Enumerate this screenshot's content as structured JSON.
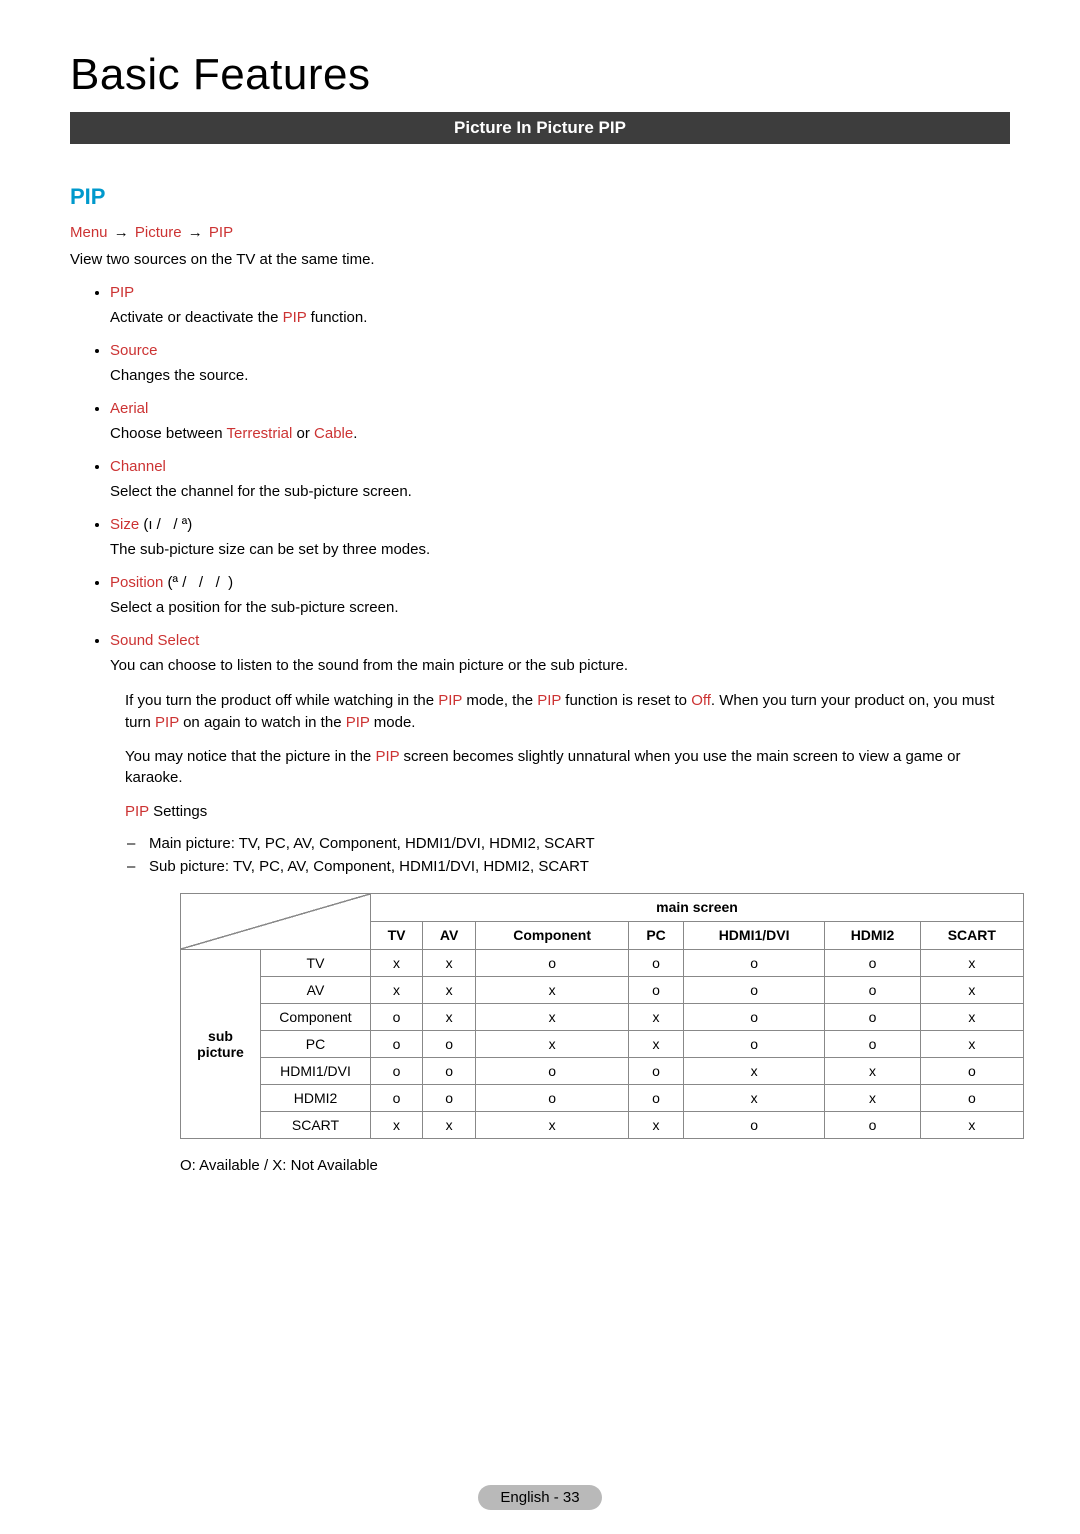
{
  "header": {
    "title": "Basic Features",
    "banner": "Picture In Picture PIP"
  },
  "section": {
    "title": "PIP",
    "breadcrumb": [
      "Menu",
      "Picture",
      "PIP"
    ],
    "intro": "View two sources on the TV at the same time."
  },
  "items": [
    {
      "title": "PIP",
      "desc_parts": [
        {
          "t": "Activate or deactivate the "
        },
        {
          "t": "PIP",
          "hl": true
        },
        {
          "t": " function."
        }
      ]
    },
    {
      "title": "Source",
      "desc_parts": [
        {
          "t": "Changes the source."
        }
      ]
    },
    {
      "title": "Aerial",
      "desc_parts": [
        {
          "t": "Choose between "
        },
        {
          "t": "Terrestrial",
          "hl": true
        },
        {
          "t": " or "
        },
        {
          "t": "Cable",
          "hl": true
        },
        {
          "t": "."
        }
      ]
    },
    {
      "title": "Channel",
      "desc_parts": [
        {
          "t": "Select the channel for the sub-picture screen."
        }
      ]
    },
    {
      "title": "Size",
      "suffix": " (ı /   / ª)",
      "desc_parts": [
        {
          "t": "The sub-picture size can be set by three modes."
        }
      ]
    },
    {
      "title": "Position",
      "suffix": " (ª /   /   /  )",
      "desc_parts": [
        {
          "t": "Select a position for the sub-picture screen."
        }
      ]
    },
    {
      "title": "Sound Select",
      "desc_parts": [
        {
          "t": "You can choose to listen to the sound from the main picture or the sub picture."
        }
      ]
    }
  ],
  "notes": {
    "p1_parts": [
      {
        "t": "If you turn the product off while watching in the "
      },
      {
        "t": "PIP",
        "hl": true
      },
      {
        "t": " mode, the "
      },
      {
        "t": "PIP",
        "hl": true
      },
      {
        "t": " function is reset to "
      },
      {
        "t": "Off",
        "hl": true
      },
      {
        "t": ". When you turn your product on, you must turn "
      },
      {
        "t": "PIP",
        "hl": true
      },
      {
        "t": " on again to watch in the "
      },
      {
        "t": "PIP",
        "hl": true
      },
      {
        "t": " mode."
      }
    ],
    "p2_parts": [
      {
        "t": "You may notice that the picture in the "
      },
      {
        "t": "PIP",
        "hl": true
      },
      {
        "t": " screen becomes slightly unnatural when you use the main screen to view a game or karaoke."
      }
    ],
    "settings_label_parts": [
      {
        "t": "PIP",
        "hl": true
      },
      {
        "t": " Settings"
      }
    ],
    "dash_list": [
      "Main picture: TV, PC, AV, Component, HDMI1/DVI, HDMI2, SCART",
      "Sub picture: TV, PC, AV, Component, HDMI1/DVI, HDMI2, SCART"
    ]
  },
  "table": {
    "main_header": "main screen",
    "side_header": "sub picture",
    "cols": [
      "TV",
      "AV",
      "Component",
      "PC",
      "HDMI1/DVI",
      "HDMI2",
      "SCART"
    ],
    "rows": [
      {
        "label": "TV",
        "cells": [
          "x",
          "x",
          "o",
          "o",
          "o",
          "o",
          "x"
        ]
      },
      {
        "label": "AV",
        "cells": [
          "x",
          "x",
          "x",
          "o",
          "o",
          "o",
          "x"
        ]
      },
      {
        "label": "Component",
        "cells": [
          "o",
          "x",
          "x",
          "x",
          "o",
          "o",
          "x"
        ]
      },
      {
        "label": "PC",
        "cells": [
          "o",
          "o",
          "x",
          "x",
          "o",
          "o",
          "x"
        ]
      },
      {
        "label": "HDMI1/DVI",
        "cells": [
          "o",
          "o",
          "o",
          "o",
          "x",
          "x",
          "o"
        ]
      },
      {
        "label": "HDMI2",
        "cells": [
          "o",
          "o",
          "o",
          "o",
          "x",
          "x",
          "o"
        ]
      },
      {
        "label": "SCART",
        "cells": [
          "x",
          "x",
          "x",
          "x",
          "o",
          "o",
          "x"
        ]
      }
    ],
    "legend": "O: Available / X: Not Available"
  },
  "footer": {
    "page_label": "English - 33"
  }
}
